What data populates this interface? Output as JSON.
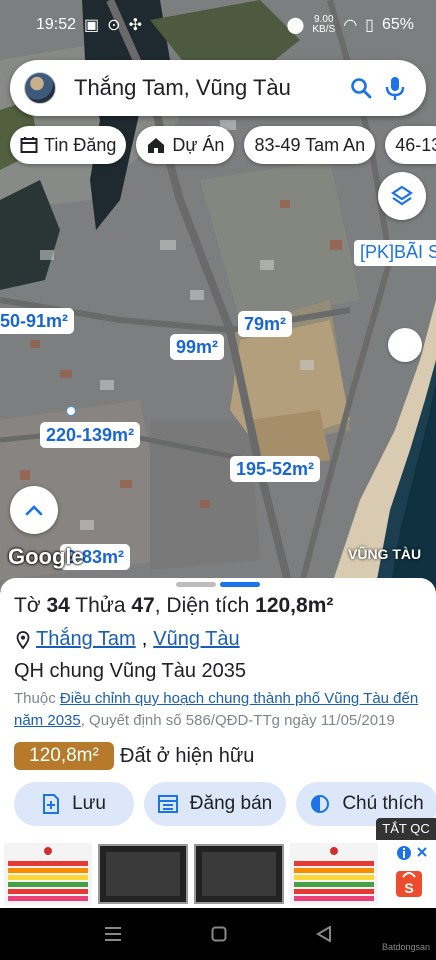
{
  "status_bar": {
    "time": "19:52",
    "net_speed": "9.00",
    "net_unit": "KB/S",
    "battery": "65%"
  },
  "search": {
    "query": "Thắng Tam, Vũng Tàu"
  },
  "chips": [
    {
      "label": "Tin Đăng",
      "icon": "calendar-icon"
    },
    {
      "label": "Dự Án",
      "icon": "house-icon"
    },
    {
      "label": "83-49 Tam An",
      "icon": ""
    },
    {
      "label": "46-13",
      "icon": ""
    }
  ],
  "map": {
    "pk_label": "[PK]BÃI S",
    "area_labels": [
      "50-91m²",
      "79m²",
      "99m²",
      "220-139m²",
      "195-52m²",
      "2-83m²"
    ],
    "google_logo": "Google",
    "city_label": "VŨNG TÀU"
  },
  "parcel": {
    "title_prefix": "Tờ",
    "sheet_no": "34",
    "plot_label": "Thửa",
    "plot_no": "47",
    "area_label": "Diện tích",
    "area_value": "120,8m²",
    "ward": "Thắng Tam",
    "city": "Vũng Tàu",
    "plan_title": "QH chung Vũng Tàu 2035",
    "plan_prefix": "Thuộc",
    "plan_link": "Điều chỉnh quy hoạch chung thành phố Vũng Tàu đến năm 2035",
    "plan_decision": ", Quyết định số 586/QĐD-TTg ngày 11/05/2019",
    "land_area": "120,8m²",
    "land_type": "Đất ở hiện hữu"
  },
  "actions": [
    {
      "label": "Lưu",
      "icon": "save-plus-icon"
    },
    {
      "label": "Đăng bán",
      "icon": "list-post-icon"
    },
    {
      "label": "Chú thích",
      "icon": "legend-icon"
    }
  ],
  "ad": {
    "close_label": "TẮT QC",
    "watermark": "Batdongsan"
  },
  "colors": {
    "accent": "#1a73e8",
    "land_badge": "#b7792a",
    "action_bg": "#dde7fa"
  }
}
